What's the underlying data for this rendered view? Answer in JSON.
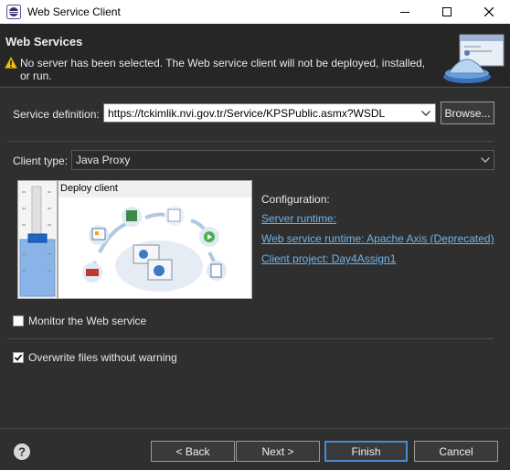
{
  "window": {
    "title": "Web Service Client"
  },
  "header": {
    "title": "Web Services",
    "warning": "No server has been selected. The Web service client will not be deployed, installed, or run."
  },
  "service_definition": {
    "label": "Service definition:",
    "value": "https://tckimlik.nvi.gov.tr/Service/KPSPublic.asmx?WSDL",
    "browse_label": "Browse..."
  },
  "client_type": {
    "label": "Client type:",
    "value": "Java Proxy"
  },
  "deploy": {
    "label": "Deploy client",
    "slider_level": "deploy client"
  },
  "configuration": {
    "title": "Configuration:",
    "server_runtime": "Server runtime: ",
    "ws_runtime": "Web service runtime: Apache Axis (Deprecated)",
    "client_project": "Client project: Day4Assign1"
  },
  "monitor": {
    "label": "Monitor the Web service",
    "checked": false
  },
  "overwrite": {
    "label": "Overwrite files without warning",
    "checked": true
  },
  "buttons": {
    "back": "< Back",
    "next": "Next >",
    "finish": "Finish",
    "cancel": "Cancel"
  },
  "colors": {
    "link": "#6fb3e8",
    "background": "#2f2f2f",
    "default_button": "#4a8ad0"
  }
}
